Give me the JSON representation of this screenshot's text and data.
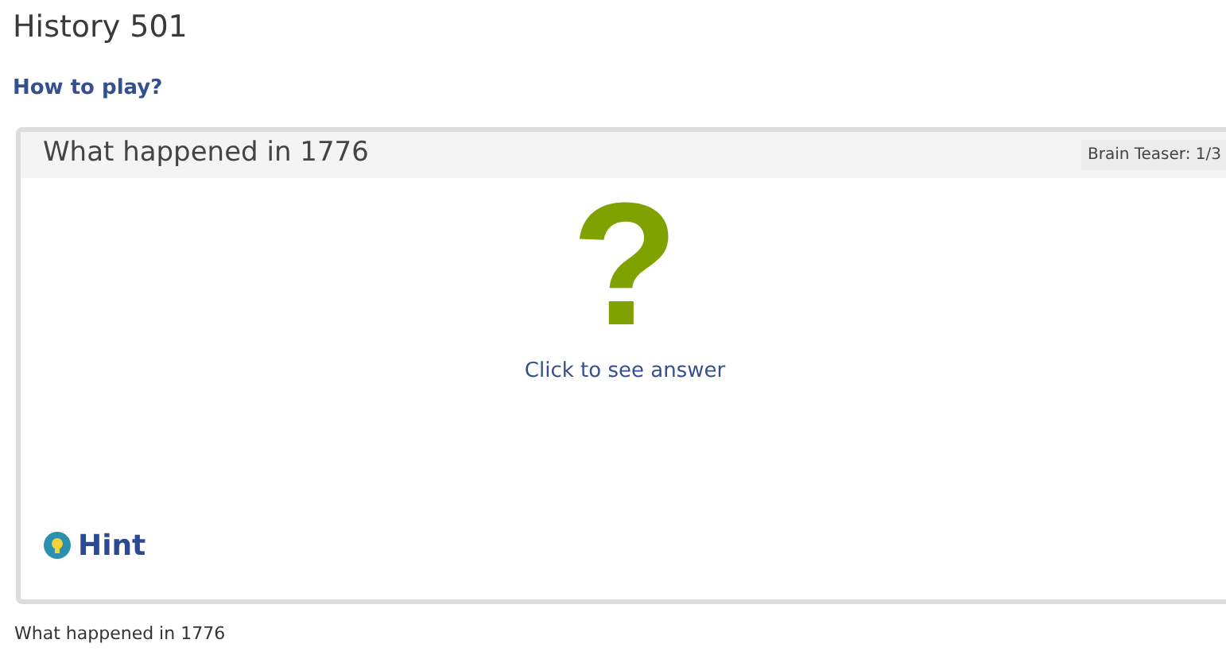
{
  "title": "History 501",
  "help_link": "How to play?",
  "card": {
    "question": "What happened in 1776",
    "counter": "Brain Teaser: 1/3",
    "mystery_glyph": "?",
    "reveal_link": "Click to see answer",
    "hint_link": "Hint"
  },
  "footer_text": "What happened in 1776"
}
